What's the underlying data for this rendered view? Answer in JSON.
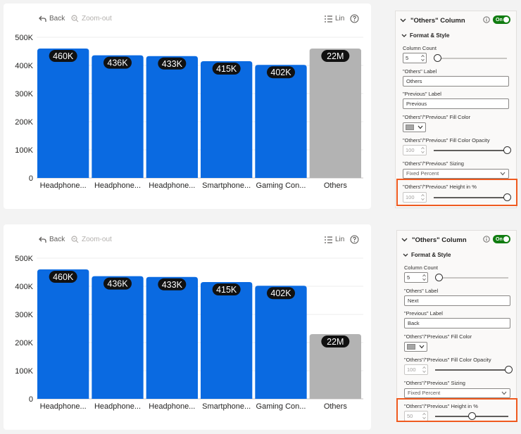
{
  "toolbar": {
    "back_label": "Back",
    "zoomout_label": "Zoom-out",
    "scale_label": "Lin"
  },
  "colors": {
    "bar": "#0a6ae1",
    "others": "#b3b3b3",
    "highlight": "#ef5a1f",
    "toggle": "#107c10"
  },
  "charts": [
    {
      "chart_data": {
        "type": "bar",
        "categories": [
          "Headphone...",
          "Headphone...",
          "Headphone...",
          "Smartphone...",
          "Gaming Con...",
          "Others"
        ],
        "values": [
          460000,
          436000,
          433000,
          415000,
          402000,
          22000000
        ],
        "data_labels": [
          "460K",
          "436K",
          "433K",
          "415K",
          "402K",
          "22M"
        ],
        "others_height_percent": 100,
        "ylim": [
          0,
          500000
        ],
        "yticks": [
          0,
          100000,
          200000,
          300000,
          400000,
          500000
        ],
        "ytick_labels": [
          "0",
          "100K",
          "200K",
          "300K",
          "400K",
          "500K"
        ],
        "grid": true
      }
    },
    {
      "chart_data": {
        "type": "bar",
        "categories": [
          "Headphone...",
          "Headphone...",
          "Headphone...",
          "Smartphone...",
          "Gaming Con...",
          "Others"
        ],
        "values": [
          460000,
          436000,
          433000,
          415000,
          402000,
          22000000
        ],
        "data_labels": [
          "460K",
          "436K",
          "433K",
          "415K",
          "402K",
          "22M"
        ],
        "others_height_percent": 50,
        "ylim": [
          0,
          500000
        ],
        "yticks": [
          0,
          100000,
          200000,
          300000,
          400000,
          500000
        ],
        "ytick_labels": [
          "0",
          "100K",
          "200K",
          "300K",
          "400K",
          "500K"
        ],
        "grid": true
      }
    }
  ],
  "panels": [
    {
      "title": "\"Others\" Column",
      "toggle_label": "On",
      "section_title": "Format & Style",
      "column_count_label": "Column Count",
      "column_count_value": "5",
      "column_count_fraction": 0.05,
      "others_label_label": "\"Others\" Label",
      "others_label_value": "Others",
      "previous_label_label": "\"Previous\" Label",
      "previous_label_value": "Previous",
      "fill_color_label": "\"Others\"/\"Previous\" Fill Color",
      "opacity_label": "\"Others\"/\"Previous\" Fill Color Opacity",
      "opacity_value": "100",
      "opacity_fraction": 1.0,
      "sizing_label": "\"Others\"/\"Previous\" Sizing",
      "sizing_value": "Fixed Percent",
      "height_label": "\"Others\"/\"Previous\" Height in %",
      "height_value": "100",
      "height_fraction": 1.0
    },
    {
      "title": "\"Others\" Column",
      "toggle_label": "On",
      "section_title": "Format & Style",
      "column_count_label": "Column Count",
      "column_count_value": "5",
      "column_count_fraction": 0.05,
      "others_label_label": "\"Others\" Label",
      "others_label_value": "Next",
      "previous_label_label": "\"Previous\" Label",
      "previous_label_value": "Back",
      "fill_color_label": "\"Others\"/\"Previous\" Fill Color",
      "opacity_label": "\"Others\"/\"Previous\" Fill Color Opacity",
      "opacity_value": "100",
      "opacity_fraction": 1.0,
      "sizing_label": "\"Others\"/\"Previous\" Sizing",
      "sizing_value": "Fixed Percent",
      "height_label": "\"Others\"/\"Previous\" Height in %",
      "height_value": "50",
      "height_fraction": 0.5
    }
  ]
}
